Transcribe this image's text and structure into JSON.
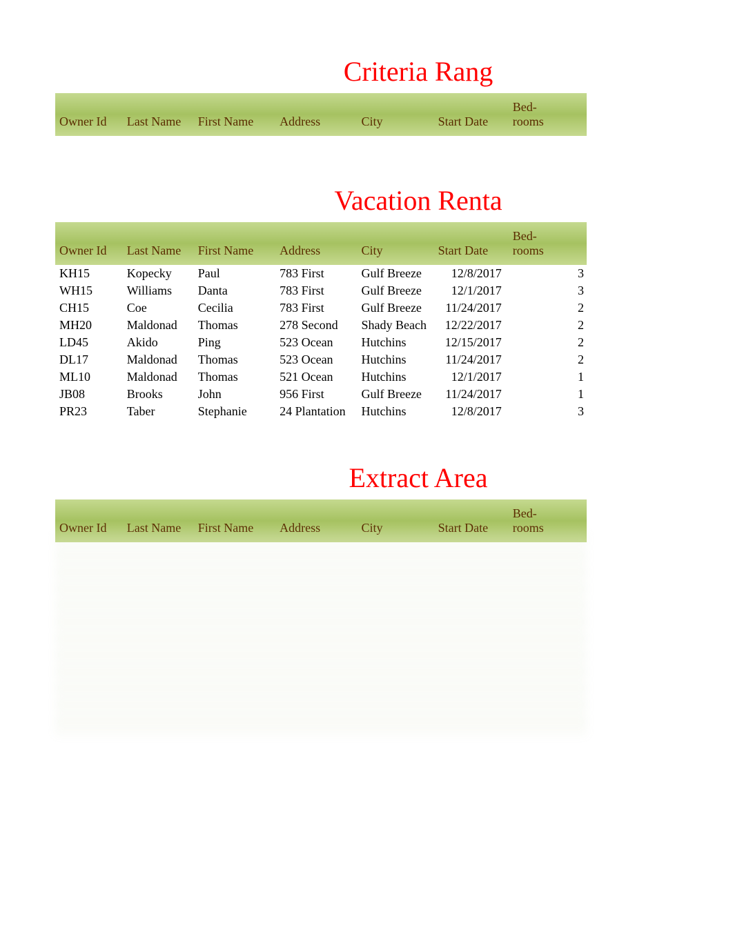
{
  "sections": {
    "criteria": {
      "title": "Criteria Rang"
    },
    "vacation": {
      "title": "Vacation Renta"
    },
    "extract": {
      "title": "Extract Area"
    }
  },
  "headers": {
    "owner_id": "Owner Id",
    "last_name": "Last Name",
    "first_name": "First Name",
    "address": "Address",
    "city": "City",
    "start_date": "Start Date",
    "bedrooms": "Bed-\nrooms"
  },
  "chart_data": {
    "type": "table",
    "title": "Vacation Rentals",
    "columns": [
      "Owner Id",
      "Last Name",
      "First Name",
      "Address",
      "City",
      "Start Date",
      "Bedrooms"
    ],
    "rows": [
      [
        "KH15",
        "Kopecky",
        "Paul",
        "783 First",
        "Gulf Breeze",
        "12/8/2017",
        3
      ],
      [
        "WH15",
        "Williams",
        "Danta",
        "783 First",
        "Gulf Breeze",
        "12/1/2017",
        3
      ],
      [
        "CH15",
        "Coe",
        "Cecilia",
        "783 First",
        "Gulf Breeze",
        "11/24/2017",
        2
      ],
      [
        "MH20",
        "Maldonad",
        "Thomas",
        "278 Second",
        "Shady Beach",
        "12/22/2017",
        2
      ],
      [
        "LD45",
        "Akido",
        "Ping",
        "523 Ocean",
        "Hutchins",
        "12/15/2017",
        2
      ],
      [
        "DL17",
        "Maldonad",
        "Thomas",
        "523 Ocean",
        "Hutchins",
        "11/24/2017",
        2
      ],
      [
        "ML10",
        "Maldonad",
        "Thomas",
        "521 Ocean",
        "Hutchins",
        "12/1/2017",
        1
      ],
      [
        "JB08",
        "Brooks",
        "John",
        "956 First",
        "Gulf Breeze",
        "11/24/2017",
        1
      ],
      [
        "PR23",
        "Taber",
        "Stephanie",
        "24 Plantation",
        "Hutchins",
        "12/8/2017",
        3
      ]
    ]
  },
  "extract_blank_rows": 10
}
